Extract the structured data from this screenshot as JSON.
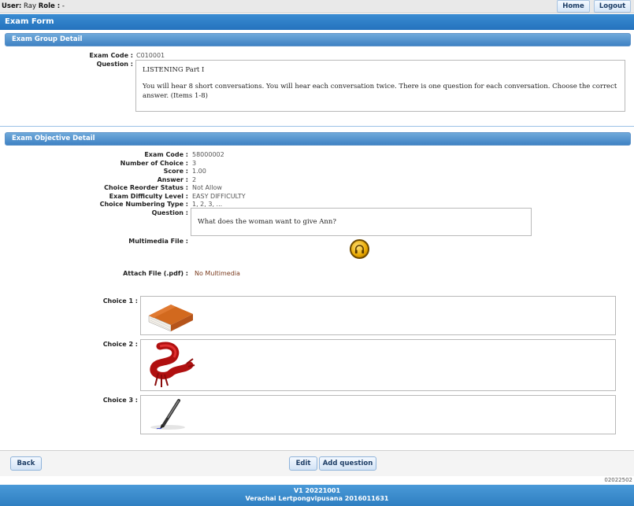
{
  "topbar": {
    "user_label": "User:",
    "user_name": "Ray",
    "role_label": "Role :",
    "role_value": "-",
    "home_label": "Home",
    "logout_label": "Logout"
  },
  "title": "Exam Form",
  "group_section": {
    "header": "Exam Group Detail",
    "exam_code_label": "Exam Code :",
    "exam_code": "C010001",
    "question_label": "Question :",
    "question_title": "LISTENING Part I",
    "question_text": "You will hear 8 short conversations.  You will hear each conversation twice.  There is one question for each conversation. Choose the correct answer. (Items 1-8)"
  },
  "objective_section": {
    "header": "Exam Objective Detail",
    "fields": [
      {
        "label": "Exam Code :",
        "value": "58000002"
      },
      {
        "label": "Number of Choice :",
        "value": "3"
      },
      {
        "label": "Score :",
        "value": "1.00"
      },
      {
        "label": "Answer :",
        "value": "2"
      },
      {
        "label": "Choice Reorder Status :",
        "value": "Not Allow"
      },
      {
        "label": "Exam Difficulty Level :",
        "value": "EASY DIFFICULTY"
      },
      {
        "label": "Choice Numbering Type :",
        "value": "1, 2, 3, ..."
      }
    ],
    "question_label": "Question :",
    "question_text": "What does the woman want to give Ann?",
    "multimedia_label": "Multimedia File :",
    "multimedia_icon": "headphones-icon",
    "attach_label": "Attach File (.pdf) :",
    "attach_value": "No Multimedia",
    "choices": [
      {
        "label": "Choice 1 :",
        "image": "book-icon"
      },
      {
        "label": "Choice 2 :",
        "image": "scarf-icon"
      },
      {
        "label": "Choice 3 :",
        "image": "pen-icon"
      }
    ]
  },
  "footer": {
    "back_label": "Back",
    "edit_label": "Edit",
    "add_question_label": "Add question",
    "page_code": "02022502"
  },
  "bottombar": {
    "version": "V1 20221001",
    "author": "Verachai Lertpongvipusana 2016011631"
  }
}
